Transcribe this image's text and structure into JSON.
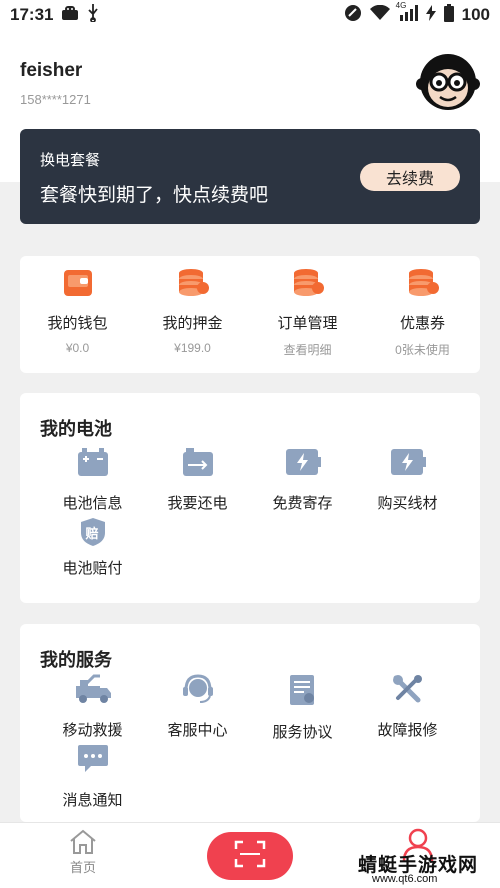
{
  "status_bar": {
    "time": "17:31",
    "battery": "100",
    "net": "4G"
  },
  "user": {
    "name": "feisher",
    "phone": "158****1271"
  },
  "plan": {
    "title": "换电套餐",
    "desc": "套餐快到期了，快点续费吧",
    "button": "去续费"
  },
  "wallet": [
    {
      "label": "我的钱包",
      "sub": "¥0.0",
      "icon": "wallet-icon"
    },
    {
      "label": "我的押金",
      "sub": "¥199.0",
      "icon": "coins-icon"
    },
    {
      "label": "订单管理",
      "sub": "查看明细",
      "icon": "coins-icon"
    },
    {
      "label": "优惠券",
      "sub": "0张未使用",
      "icon": "coins-icon"
    }
  ],
  "battery_section": {
    "title": "我的电池",
    "items": [
      {
        "label": "电池信息",
        "icon": "battery-info-icon"
      },
      {
        "label": "我要还电",
        "icon": "battery-return-icon"
      },
      {
        "label": "免费寄存",
        "icon": "storage-icon"
      },
      {
        "label": "购买线材",
        "icon": "cable-icon"
      },
      {
        "label": "电池赔付",
        "icon": "compensation-icon",
        "badge": "赔"
      }
    ]
  },
  "service_section": {
    "title": "我的服务",
    "items": [
      {
        "label": "移动救援",
        "icon": "rescue-truck-icon"
      },
      {
        "label": "客服中心",
        "icon": "headset-icon"
      },
      {
        "label": "服务协议",
        "icon": "agreement-icon"
      },
      {
        "label": "故障报修",
        "icon": "repair-tools-icon"
      },
      {
        "label": "消息通知",
        "icon": "message-icon"
      }
    ]
  },
  "tabbar": {
    "home": "首页"
  },
  "watermark": {
    "main": "蜻蜓手游戏网",
    "sub": "www.qt6.com"
  },
  "colors": {
    "accent": "#f0414f",
    "card_dark": "#2c3441",
    "icon_orange": "#f26a32",
    "icon_gray": "#8fa3bf"
  }
}
